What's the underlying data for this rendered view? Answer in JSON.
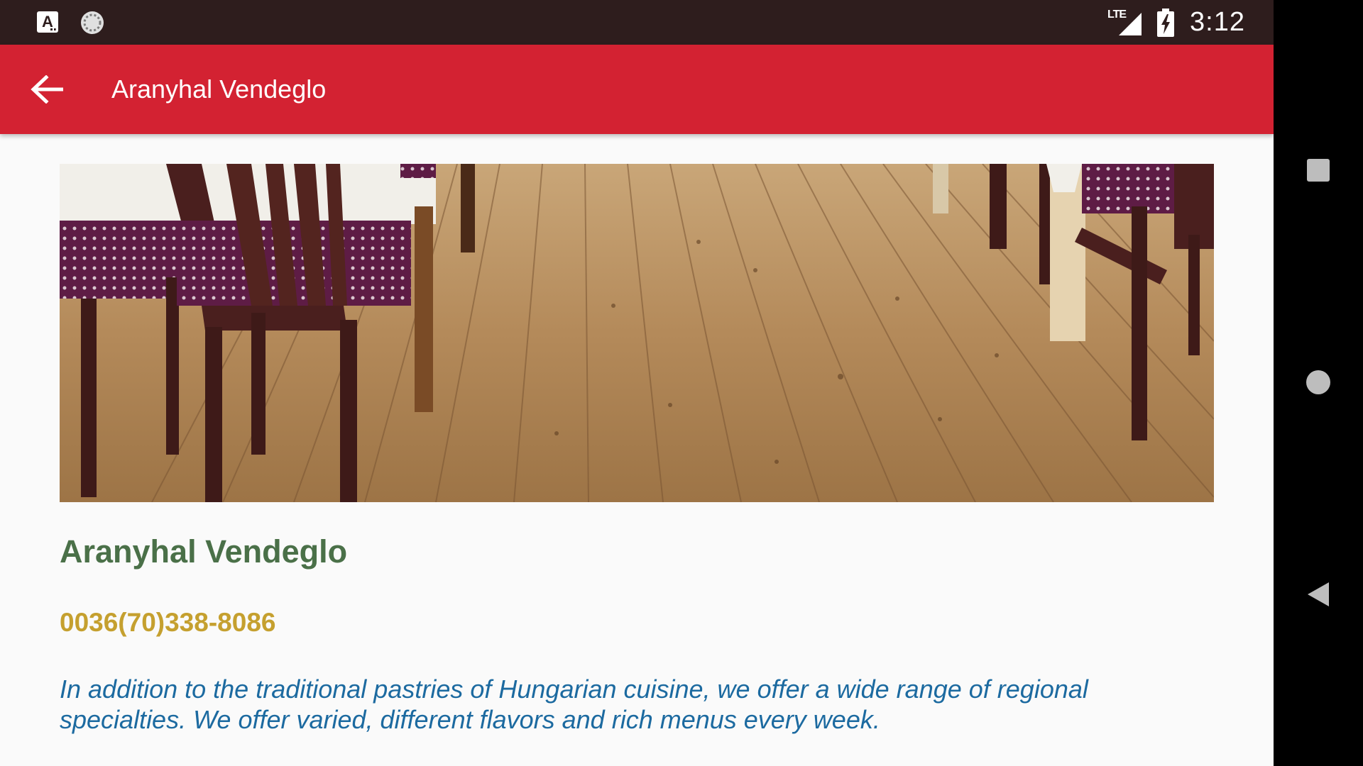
{
  "status_bar": {
    "app_letter": "A",
    "network": "LTE",
    "time": "3:12"
  },
  "app_bar": {
    "back_icon": "arrow-back-icon",
    "title": "Aranyhal Vendeglo"
  },
  "hero": {
    "image": "restaurant-wood-floor-photo"
  },
  "content": {
    "name": "Aranyhal Vendeglo",
    "phone": "0036(70)338-8086",
    "description": "In addition to the traditional pastries of Hungarian cuisine, we offer a wide range of regional specialties. We offer varied, different flavors and rich menus every week."
  },
  "nav_bar": {
    "recents_icon": "square-recents-icon",
    "home_icon": "circle-home-icon",
    "back_icon": "triangle-back-icon"
  },
  "colors": {
    "status_bar": "#2e1d1d",
    "app_bar": "#d32232",
    "name": "#4a7048",
    "phone": "#c5a02f",
    "description": "#1c6aa0",
    "background": "#fafafa"
  }
}
